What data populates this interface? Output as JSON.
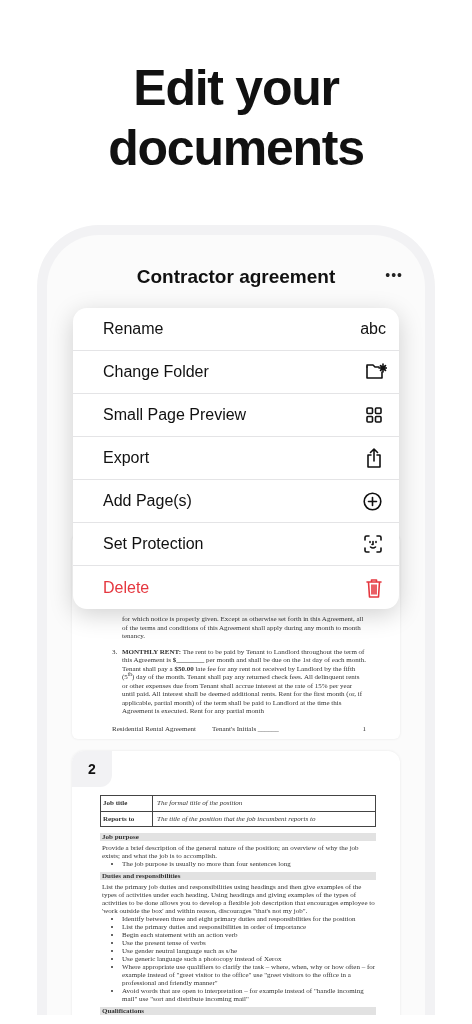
{
  "headline": "Edit your documents",
  "document_title": "Contractor agreement",
  "more_button": "•••",
  "menu": [
    {
      "label": "Rename",
      "trailing_text": "abc",
      "destructive": false
    },
    {
      "label": "Change Folder",
      "destructive": false
    },
    {
      "label": "Small Page Preview",
      "destructive": false
    },
    {
      "label": "Export",
      "destructive": false
    },
    {
      "label": "Add Page(s)",
      "destructive": false
    },
    {
      "label": "Set Protection",
      "destructive": false
    },
    {
      "label": "Delete",
      "destructive": true
    }
  ],
  "page_1": {
    "paragraph": "for which notice is properly given. Except as otherwise set forth in this Agreement, all of the terms and conditions of this Agreement shall apply during any month to month tenancy.",
    "item": {
      "number": "3.",
      "text": "**MONTHLY RENT:** The rent to be paid by Tenant to Landlord throughout the term of this Agreement is **$________** per month and shall be due on the 1st day of each month. Tenant shall pay a **$50.00** late fee for any rent not received by Landlord by the fifth (5$^{th}$) day of the month. Tenant shall pay any returned check fees. All delinquent rents or other expenses due from Tenant shall accrue interest at the rate of 15% per year until paid. All interest shall be deemed additional rents. Rent for the first month (or, if applicable, partial month) of the term shall be paid to Landlord at the time this Agreement is executed. Rent for any partial month"
    },
    "footer": [
      "Residential Rental Agreement",
      "Tenant's Initials ______",
      "1"
    ]
  },
  "page_2": {
    "number": "2",
    "table": [
      {
        "label": "Job title",
        "value": "The formal title of the position"
      },
      {
        "label": "Reports to",
        "value": "The title of the position that the job incumbent reports to"
      }
    ],
    "sections": [
      {
        "heading": "Job purpose",
        "body": "Provide a brief description of the general nature of the position; an overview of why the job exists; and what the job is to accomplish.",
        "bullets": [
          "The job purpose is usually no more than four sentences long"
        ]
      },
      {
        "heading": "Duties and responsibilities",
        "body": "List the primary job duties and responsibilities using headings and then give examples of the types of activities under each heading. Using headings and giving examples of the types of activities to be done allows you to develop a flexible job description that encourages employee to 'work outside the box' and within reason, discourages \"that's not my job\".",
        "bullets": [
          "Identify between three and eight primary duties and responsibilities for the position",
          "List the primary duties and responsibilities in order of importance",
          "Begin each statement with an action verb",
          "Use the present tense of verbs",
          "Use gender neutral language such as s/he",
          "Use generic language such a photocopy instead of Xerox",
          "Where appropriate use qualifiers to clarify the task – where, when, why or how often – for example instead of \"greet visitor to the office\" use \"greet visitors to the office in a professional and friendly manner\"",
          "Avoid words that are open to interpretation – for example instead of \"handle incoming mail\" use \"sort and distribute incoming mail\""
        ]
      },
      {
        "heading": "Qualifications"
      }
    ]
  }
}
